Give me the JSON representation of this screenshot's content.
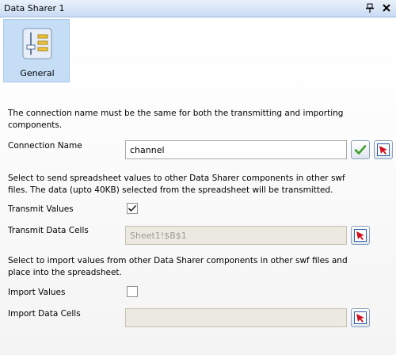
{
  "window": {
    "title": "Data Sharer 1",
    "pin_icon": "pin-icon",
    "close_icon": "close-icon"
  },
  "tabs": [
    {
      "label": "General",
      "icon": "sliders-icon",
      "selected": true
    }
  ],
  "connection": {
    "description": "The connection name must be the same for both the transmitting and importing components.",
    "name_label": "Connection Name",
    "name_value": "channel",
    "accept_icon": "checkmark-icon",
    "select_icon": "cell-selector-icon"
  },
  "transmit": {
    "description": "Select to send spreadsheet values to other Data Sharer components in other swf files. The data (upto 40KB) selected from the spreadsheet will be transmitted.",
    "values_label": "Transmit Values",
    "values_checked": true,
    "cells_label": "Transmit Data Cells",
    "cells_value": "Sheet1!$B$1",
    "select_icon": "cell-selector-icon"
  },
  "import": {
    "description": "Select to import values from other Data Sharer components in other swf files and place into the spreadsheet.",
    "values_label": "Import Values",
    "values_checked": false,
    "cells_label": "Import Data Cells",
    "cells_value": "",
    "select_icon": "cell-selector-icon"
  },
  "colors": {
    "title_bar": "#c9dcf3",
    "tab_selected": "#c5def5",
    "accept_green": "#3aa02a",
    "selector_red": "#d01020",
    "selector_blue": "#2a5db0"
  }
}
